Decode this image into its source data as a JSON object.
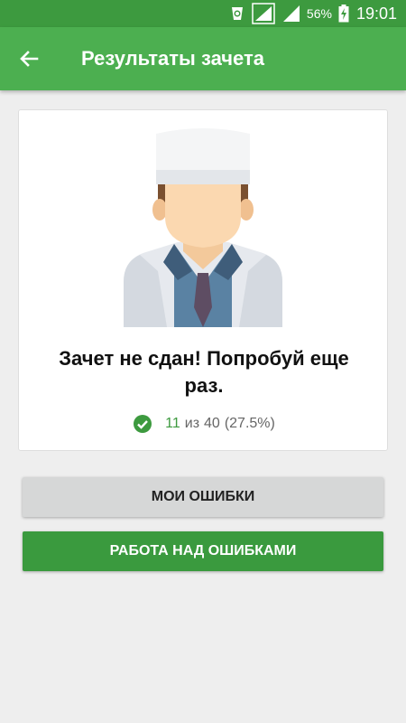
{
  "status_bar": {
    "battery_percent": "56%",
    "time": "19:01"
  },
  "app_bar": {
    "title": "Результаты зачета",
    "back_icon": "arrow-back-icon"
  },
  "result_card": {
    "avatar_icon": "doctor-avatar-icon",
    "message": "Зачет не сдан! Попробуй еще раз.",
    "score": {
      "correct": "11",
      "of_label": "из",
      "total": "40",
      "percent_text": "(27.5%)",
      "icon": "check-circle-icon"
    }
  },
  "buttons": {
    "my_mistakes": "МОИ ОШИБКИ",
    "work_on_mistakes": "РАБОТА НАД ОШИБКАМИ"
  },
  "colors": {
    "status_bar": "#3d9a3f",
    "app_bar": "#4caf50",
    "accent_green": "#3a9a3e",
    "secondary_button": "#d6d7d7",
    "background": "#eeeeee"
  }
}
